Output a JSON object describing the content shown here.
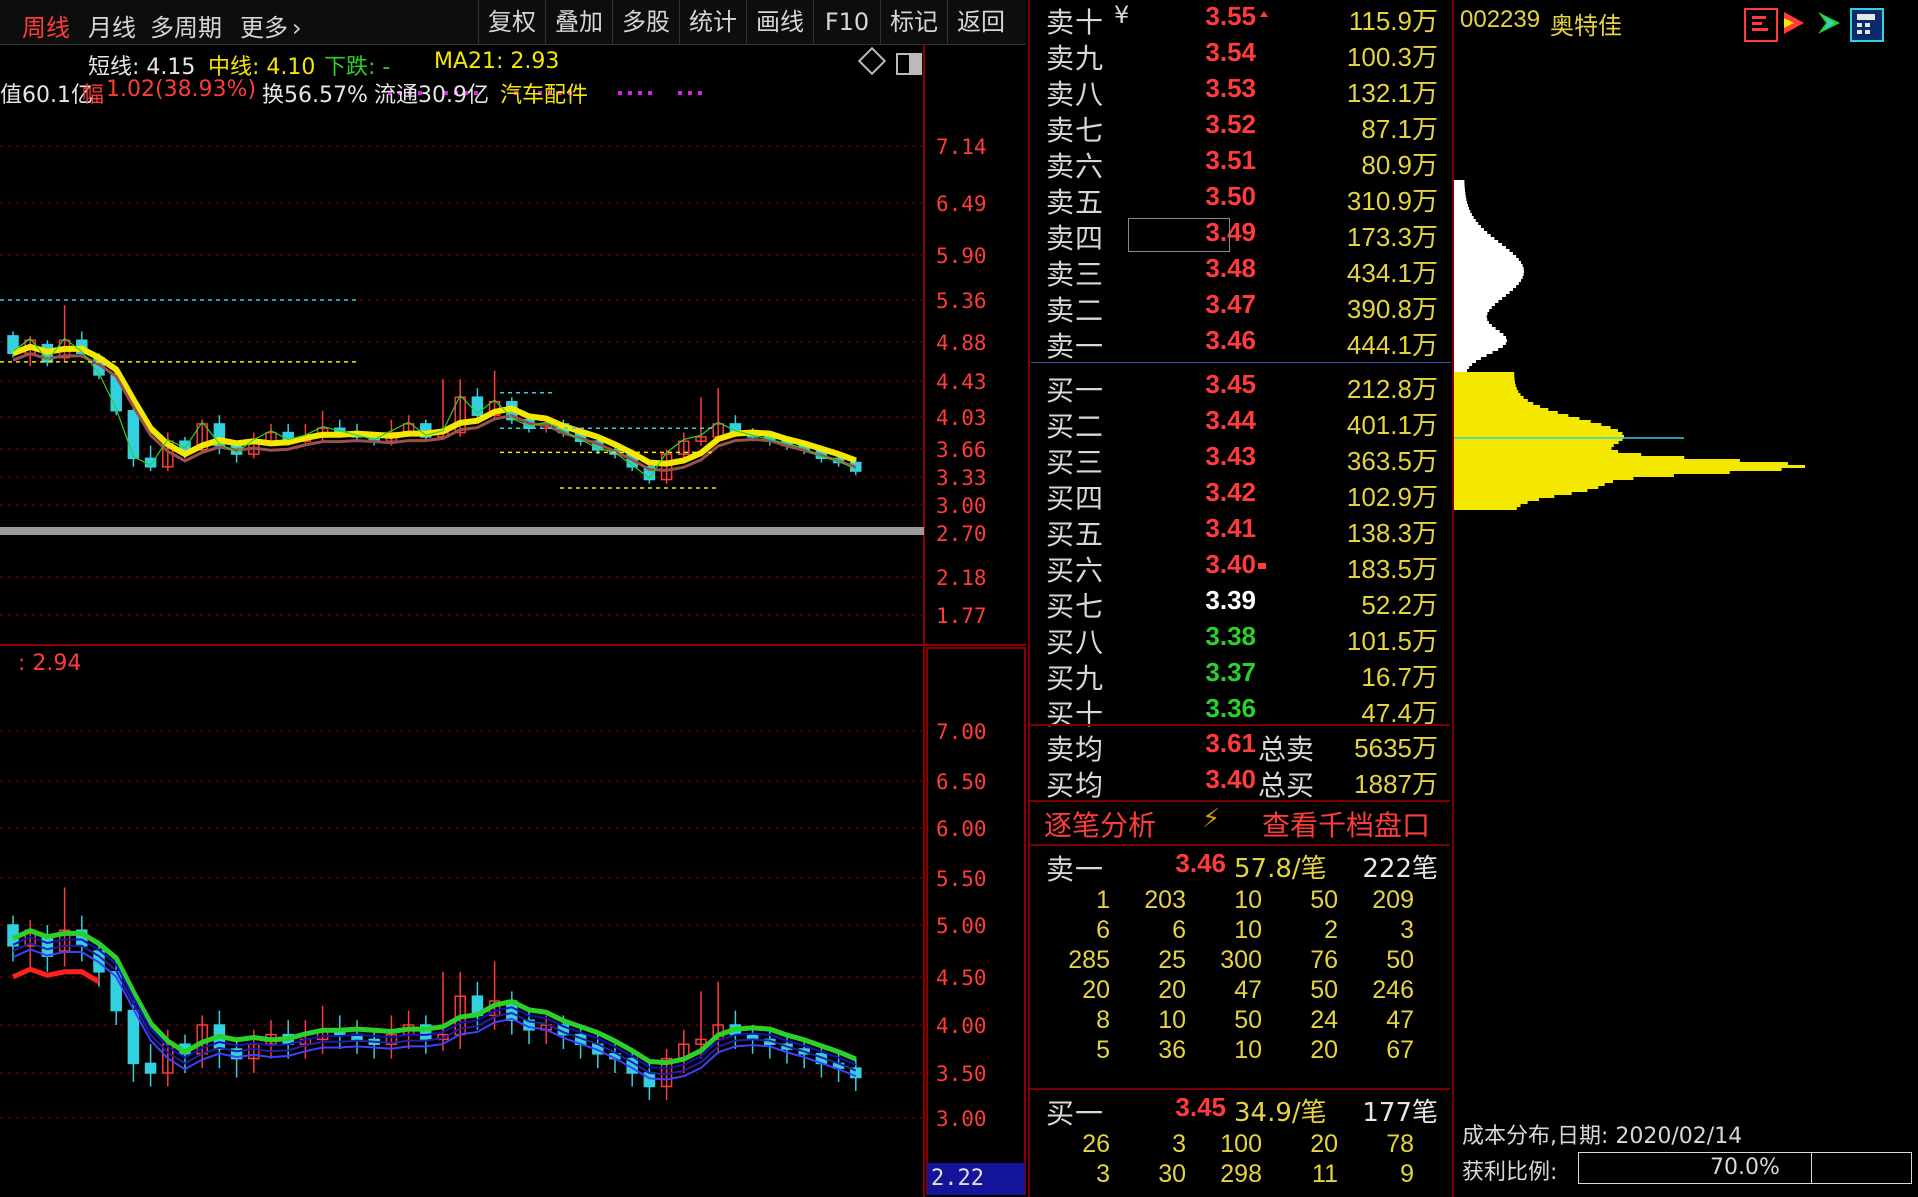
{
  "toolbar": {
    "period_items": [
      {
        "label": "周线",
        "active": true
      },
      {
        "label": "月线",
        "active": false
      },
      {
        "label": "多周期",
        "active": false
      },
      {
        "label": "更多",
        "active": false
      }
    ],
    "more_chevron": "›",
    "buttons": [
      "复权",
      "叠加",
      "多股",
      "统计",
      "画线",
      "F10",
      "标记",
      "返回"
    ]
  },
  "chart": {
    "indicator_line1": {
      "short_label": "短线: 4.15",
      "mid_label": "中线: 4.10",
      "down_label": "下跌: -",
      "ma_label": "MA21: 2.93"
    },
    "info_line2": {
      "prefix": "值60.1亿",
      "change_label": "幅",
      "change_value": "1.02(38.93%)",
      "turnover": "换56.57%",
      "float_cap": "流通30.9亿",
      "sector": "汽车配件"
    },
    "upper_axis": [
      "7.14",
      "6.49",
      "5.90",
      "5.36",
      "4.88",
      "4.43",
      "4.03",
      "3.66",
      "3.33",
      "3.00",
      "2.70",
      "2.18",
      "1.77"
    ],
    "lower_title": ": 2.94",
    "lower_axis": [
      "7.00",
      "6.50",
      "6.00",
      "5.50",
      "5.00",
      "4.50",
      "4.00",
      "3.50",
      "3.00"
    ],
    "lower_badge": "2.22",
    "colors": {
      "up": "#ff3b3b",
      "down": "#33d0e0",
      "ma_yellow": "#f5e800",
      "grid": "#8a0000"
    }
  },
  "orderbook": {
    "sell_rows": [
      {
        "label": "卖十",
        "price": "3.55",
        "vol": "115.9万",
        "color": "red",
        "marker": "¥"
      },
      {
        "label": "卖九",
        "price": "3.54",
        "vol": "100.3万",
        "color": "red"
      },
      {
        "label": "卖八",
        "price": "3.53",
        "vol": "132.1万",
        "color": "red"
      },
      {
        "label": "卖七",
        "price": "3.52",
        "vol": "87.1万",
        "color": "red"
      },
      {
        "label": "卖六",
        "price": "3.51",
        "vol": "80.9万",
        "color": "red"
      },
      {
        "label": "卖五",
        "price": "3.50",
        "vol": "310.9万",
        "color": "red"
      },
      {
        "label": "卖四",
        "price": "3.49",
        "vol": "173.3万",
        "color": "red"
      },
      {
        "label": "卖三",
        "price": "3.48",
        "vol": "434.1万",
        "color": "red"
      },
      {
        "label": "卖二",
        "price": "3.47",
        "vol": "390.8万",
        "color": "red"
      },
      {
        "label": "卖一",
        "price": "3.46",
        "vol": "444.1万",
        "color": "red"
      }
    ],
    "buy_rows": [
      {
        "label": "买一",
        "price": "3.45",
        "vol": "212.8万",
        "color": "red"
      },
      {
        "label": "买二",
        "price": "3.44",
        "vol": "401.1万",
        "color": "red"
      },
      {
        "label": "买三",
        "price": "3.43",
        "vol": "363.5万",
        "color": "red"
      },
      {
        "label": "买四",
        "price": "3.42",
        "vol": "102.9万",
        "color": "red"
      },
      {
        "label": "买五",
        "price": "3.41",
        "vol": "138.3万",
        "color": "red"
      },
      {
        "label": "买六",
        "price": "3.40",
        "vol": "183.5万",
        "color": "red"
      },
      {
        "label": "买七",
        "price": "3.39",
        "vol": "52.2万",
        "color": "white"
      },
      {
        "label": "买八",
        "price": "3.38",
        "vol": "101.5万",
        "color": "green"
      },
      {
        "label": "买九",
        "price": "3.37",
        "vol": "16.7万",
        "color": "green"
      },
      {
        "label": "买十",
        "price": "3.36",
        "vol": "47.4万",
        "color": "green"
      }
    ],
    "avg": {
      "sell_avg_label": "卖均",
      "sell_avg_price": "3.61",
      "total_sell_label": "总卖",
      "total_sell": "5635万",
      "buy_avg_label": "买均",
      "buy_avg_price": "3.40",
      "total_buy_label": "总买",
      "total_buy": "1887万"
    },
    "links": {
      "tick_analysis": "逐笔分析",
      "view_depth": "查看千档盘口"
    },
    "sell_queue": {
      "label": "卖一",
      "price": "3.46",
      "avg": "57.8/笔",
      "count": "222笔",
      "rows": [
        [
          "1",
          "203",
          "10",
          "50",
          "209"
        ],
        [
          "6",
          "6",
          "10",
          "2",
          "3"
        ],
        [
          "285",
          "25",
          "300",
          "76",
          "50"
        ],
        [
          "20",
          "20",
          "47",
          "50",
          "246"
        ],
        [
          "8",
          "10",
          "50",
          "24",
          "47"
        ],
        [
          "5",
          "36",
          "10",
          "20",
          "67"
        ]
      ]
    },
    "buy_queue": {
      "label": "买一",
      "price": "3.45",
      "avg": "34.9/笔",
      "count": "177笔",
      "rows": [
        [
          "26",
          "3",
          "100",
          "20",
          "78"
        ],
        [
          "3",
          "30",
          "298",
          "11",
          "9"
        ]
      ]
    }
  },
  "right_panel": {
    "code": "002239",
    "name": "奥特佳",
    "cost_title": "成本分布,日期: 2020/02/14",
    "profit_label": "获利比例:",
    "profit_value": "70.0%",
    "profit_fraction": 0.7,
    "icons": [
      "chart-menu-icon",
      "play-icon",
      "arrow-green-icon",
      "calculator-icon"
    ]
  }
}
